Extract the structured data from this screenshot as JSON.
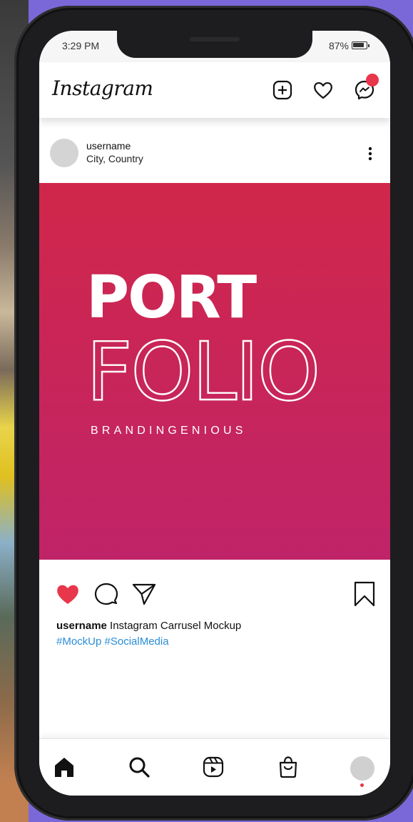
{
  "status_bar": {
    "time": "3:29 PM",
    "battery": "87%"
  },
  "header": {
    "logo": "Instagram",
    "icons": [
      "new-post-icon",
      "heart-icon",
      "messenger-icon"
    ],
    "notification_badge": true
  },
  "post": {
    "username": "username",
    "location": "City, Country",
    "image": {
      "title_solid": "PORT",
      "title_outline": "FOLIO",
      "brand": "BRANDINGENIOUS",
      "gradient": [
        "#d0264a",
        "#c02468"
      ]
    },
    "liked": true,
    "caption_user": "username",
    "caption_text": " Instagram Carrusel Mockup",
    "hashtags": "#MockUp #SocialMedia"
  },
  "bottom_nav": {
    "items": [
      "home-icon",
      "search-icon",
      "reels-icon",
      "shop-icon",
      "profile-avatar"
    ]
  },
  "colors": {
    "accent": "#e8364a",
    "link": "#2a8ed6",
    "background": "#7b68d8"
  }
}
